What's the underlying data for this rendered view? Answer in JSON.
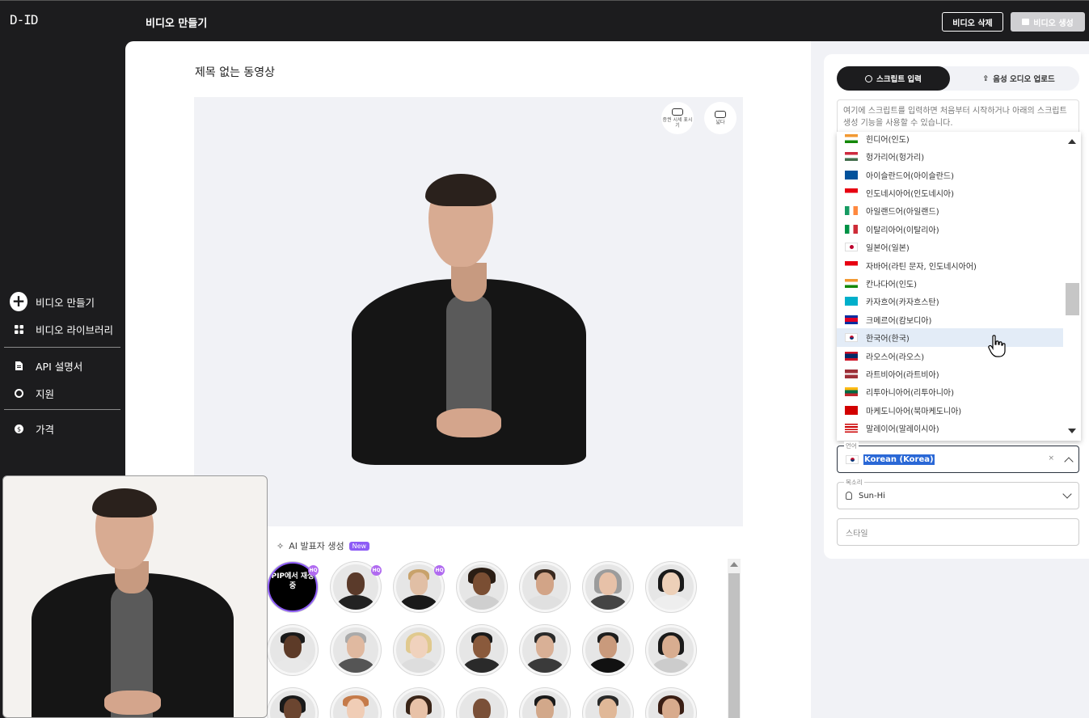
{
  "app": {
    "logo": "D-ID",
    "page_heading": "비디오 만들기"
  },
  "header": {
    "delete_label": "비디오 삭제",
    "generate_label": "비디오 생성"
  },
  "sidebar": {
    "items": [
      {
        "label": "비디오 만들기",
        "icon": "plus-circle-icon"
      },
      {
        "label": "비디오 라이브러리",
        "icon": "grid-icon"
      },
      {
        "label": "API 설명서",
        "icon": "document-icon"
      },
      {
        "label": "지원",
        "icon": "lifebuoy-icon"
      },
      {
        "label": "가격",
        "icon": "dollar-icon"
      }
    ]
  },
  "main": {
    "video_title": "제목 없는 동영상",
    "stage_buttons": [
      {
        "label": "증권 시세 표시기",
        "icon": "ticker-icon"
      },
      {
        "label": "넓다",
        "icon": "wide-icon"
      }
    ],
    "ai_presenter_label": "AI 발표자 생성",
    "new_badge": "New",
    "pip_tile_text": "PIP에서 재생 중",
    "hq_badge": "HQ"
  },
  "right_panel": {
    "tabs": [
      {
        "label": "스크립트 입력",
        "active": true
      },
      {
        "label": "음성 오디오 업로드",
        "active": false
      }
    ],
    "script_placeholder": "여기에 스크립트를 입력하면 처음부터 시작하거나 아래의 스크립트 생성 기능을 사용할 수 있습니다.",
    "languages": [
      {
        "label": "힌디어(인도)",
        "flag": "in"
      },
      {
        "label": "헝가리어(헝가리)",
        "flag": "hu"
      },
      {
        "label": "아이슬란드어(아이슬란드)",
        "flag": "is"
      },
      {
        "label": "인도네시아어(인도네시아)",
        "flag": "id"
      },
      {
        "label": "아일랜드어(아일랜드)",
        "flag": "ie"
      },
      {
        "label": "이탈리아어(이탈리아)",
        "flag": "it"
      },
      {
        "label": "일본어(일본)",
        "flag": "jp"
      },
      {
        "label": "자바어(라틴 문자, 인도네시아어)",
        "flag": "id"
      },
      {
        "label": "칸나다어(인도)",
        "flag": "in"
      },
      {
        "label": "카자흐어(카자흐스탄)",
        "flag": "kz"
      },
      {
        "label": "크메르어(캄보디아)",
        "flag": "kh"
      },
      {
        "label": "한국어(한국)",
        "flag": "kr",
        "highlighted": true
      },
      {
        "label": "라오스어(라오스)",
        "flag": "la"
      },
      {
        "label": "라트비아어(라트비아)",
        "flag": "lv"
      },
      {
        "label": "리투아니아어(리투아니아)",
        "flag": "lt"
      },
      {
        "label": "마케도니아어(북마케도니아)",
        "flag": "mk"
      },
      {
        "label": "말레이어(말레이시아)",
        "flag": "my"
      }
    ],
    "language_field": {
      "label": "언어",
      "value": "Korean (Korea)",
      "clear": "×"
    },
    "voice_field": {
      "label": "목소리",
      "value": "Sun-Hi"
    },
    "style_field": {
      "placeholder": "스타일"
    }
  },
  "colors": {
    "accent": "#8d5cf6",
    "selection": "#2a68d6",
    "dark": "#1c1c1e"
  }
}
